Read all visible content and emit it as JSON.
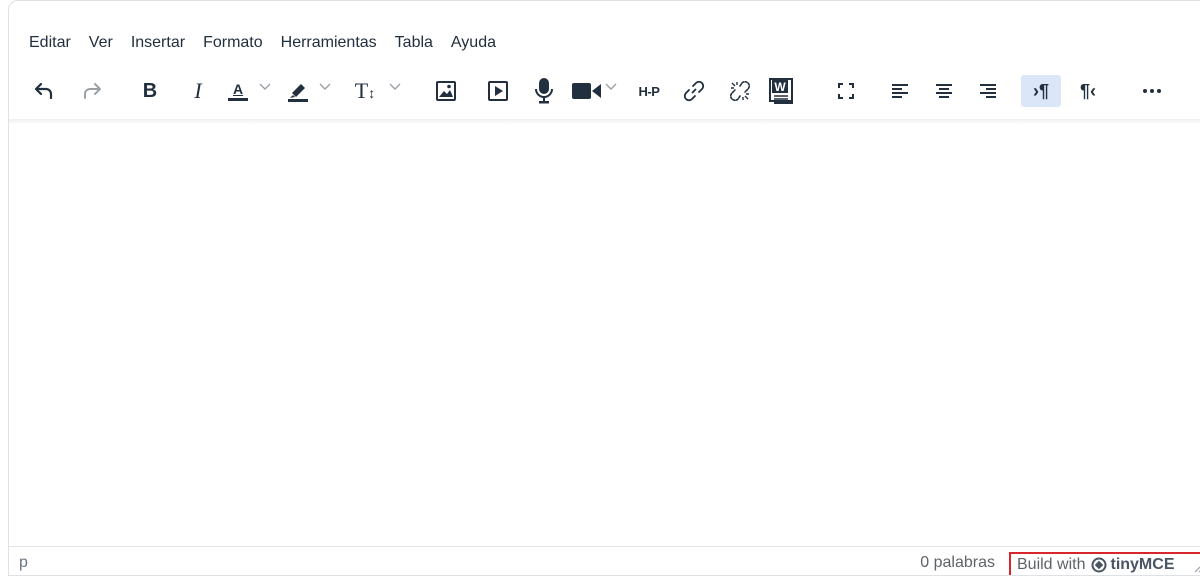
{
  "menubar": {
    "items": [
      "Editar",
      "Ver",
      "Insertar",
      "Formato",
      "Herramientas",
      "Tabla",
      "Ayuda"
    ]
  },
  "toolbar": {
    "buttons": [
      {
        "name": "undo-button",
        "icon": "undo-icon"
      },
      {
        "name": "redo-button",
        "icon": "redo-icon"
      },
      {
        "name": "bold-button",
        "icon": "bold-icon"
      },
      {
        "name": "italic-button",
        "icon": "italic-icon"
      },
      {
        "name": "text-color-button",
        "icon": "text-color-icon"
      },
      {
        "name": "highlight-color-button",
        "icon": "highlighter-icon"
      },
      {
        "name": "font-size-button",
        "icon": "text-size-icon"
      },
      {
        "name": "image-button",
        "icon": "image-icon"
      },
      {
        "name": "media-button",
        "icon": "play-icon"
      },
      {
        "name": "record-audio-button",
        "icon": "microphone-icon"
      },
      {
        "name": "record-video-button",
        "icon": "video-camera-icon"
      },
      {
        "name": "h5p-button",
        "icon": "h5p-icon"
      },
      {
        "name": "link-button",
        "icon": "link-icon"
      },
      {
        "name": "unlink-button",
        "icon": "unlink-icon"
      },
      {
        "name": "paste-from-word-button",
        "icon": "word-icon"
      },
      {
        "name": "fullscreen-button",
        "icon": "fullscreen-icon"
      },
      {
        "name": "align-left-button",
        "icon": "align-left-icon"
      },
      {
        "name": "align-center-button",
        "icon": "align-center-icon"
      },
      {
        "name": "align-right-button",
        "icon": "align-right-icon"
      },
      {
        "name": "ltr-button",
        "icon": "ltr-icon",
        "active": true
      },
      {
        "name": "rtl-button",
        "icon": "rtl-icon"
      },
      {
        "name": "more-button",
        "icon": "more-icon"
      }
    ],
    "text_color_label": "A",
    "h5p_label": "H-P",
    "word_label": "W"
  },
  "statusbar": {
    "path": "p",
    "word_count": "0 palabras",
    "branding_prefix": "Build with",
    "branding_product": "tinyMCE"
  },
  "colors": {
    "icon": "#222f3e",
    "active_bg": "#dbe6f9",
    "branding_border": "#d9262c"
  }
}
